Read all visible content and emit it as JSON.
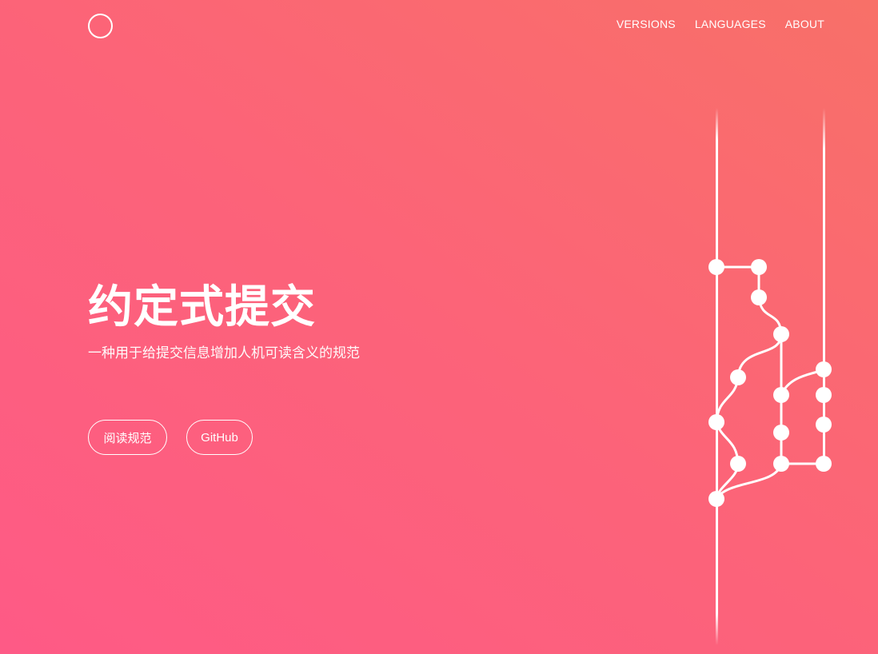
{
  "header": {
    "logo_icon": "circle-logo-icon",
    "nav": {
      "versions": "VERSIONS",
      "languages": "LANGUAGES",
      "about": "ABOUT"
    }
  },
  "hero": {
    "title": "约定式提交",
    "subtitle": "一种用于给提交信息增加人机可读含义的规范",
    "buttons": {
      "read_spec": "阅读规范",
      "github": "GitHub"
    },
    "illustration_icon": "git-branch-graph-icon"
  },
  "colors": {
    "gradient_start": "#fe5a86",
    "gradient_mid": "#fc6379",
    "gradient_end": "#f87068",
    "foreground": "#ffffff"
  }
}
